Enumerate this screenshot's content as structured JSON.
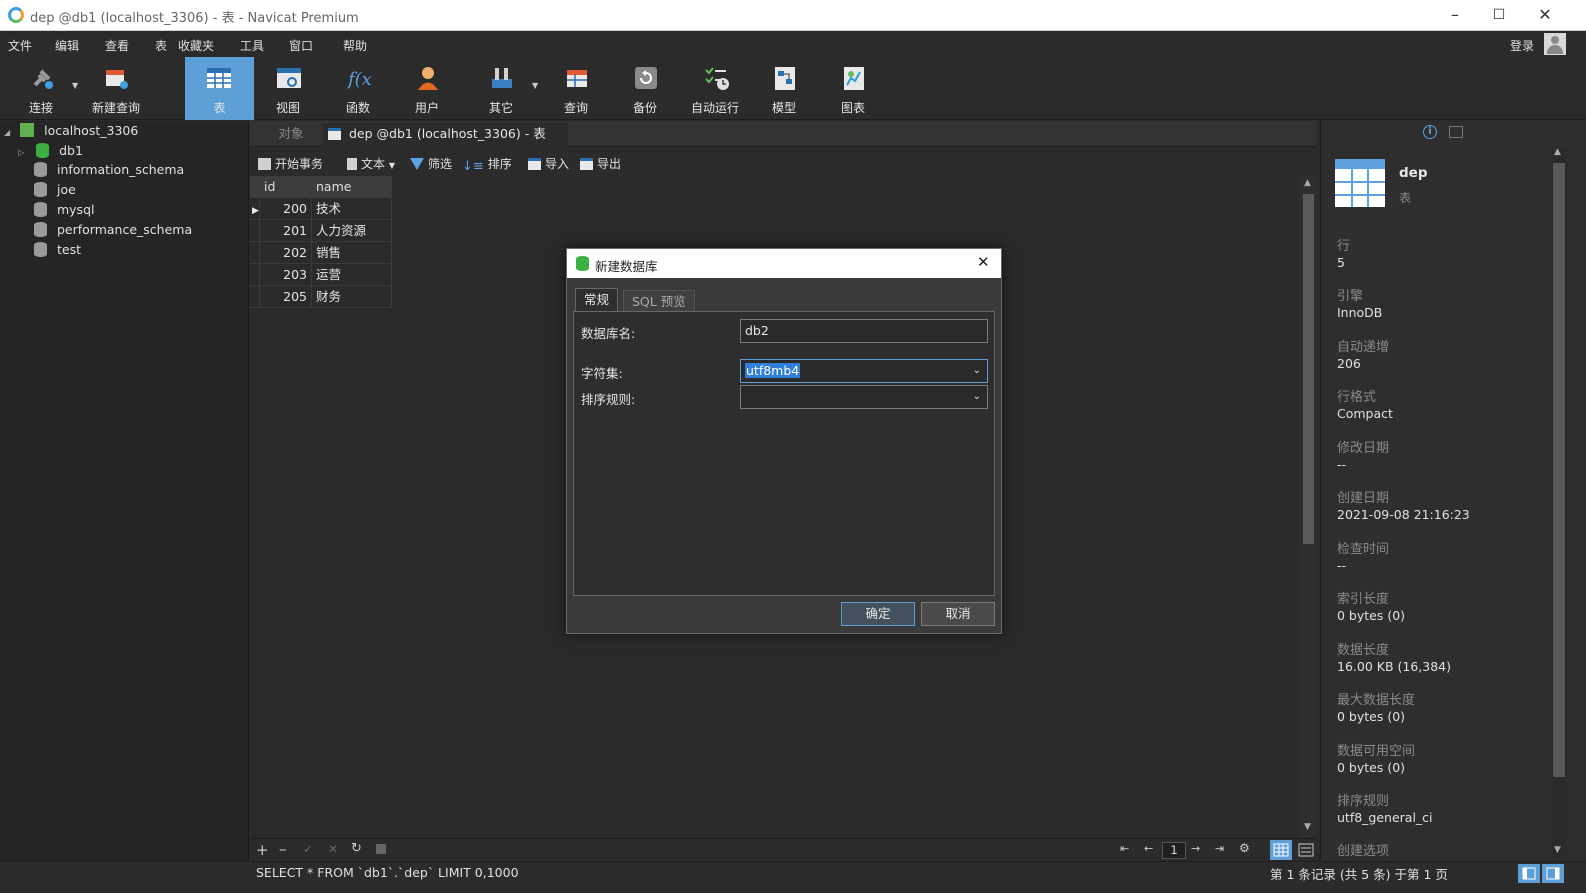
{
  "window": {
    "title": "dep @db1 (localhost_3306) - 表 - Navicat Premium"
  },
  "menu": [
    "文件",
    "编辑",
    "查看",
    "表",
    "收藏夹",
    "工具",
    "窗口",
    "帮助"
  ],
  "login_label": "登录",
  "toolbar": {
    "items": [
      {
        "label": "连接",
        "icon": "plug-icon"
      },
      {
        "label": "新建查询",
        "icon": "new-query-icon"
      },
      {
        "label": "表",
        "icon": "table-icon",
        "active": true
      },
      {
        "label": "视图",
        "icon": "view-icon"
      },
      {
        "label": "函数",
        "icon": "function-icon"
      },
      {
        "label": "用户",
        "icon": "user-icon"
      },
      {
        "label": "其它",
        "icon": "tools-icon"
      },
      {
        "label": "查询",
        "icon": "query-icon"
      },
      {
        "label": "备份",
        "icon": "backup-icon"
      },
      {
        "label": "自动运行",
        "icon": "schedule-icon"
      },
      {
        "label": "模型",
        "icon": "model-icon"
      },
      {
        "label": "图表",
        "icon": "chart-icon"
      }
    ]
  },
  "tree": {
    "connection": "localhost_3306",
    "databases": [
      "db1",
      "information_schema",
      "joe",
      "mysql",
      "performance_schema",
      "test"
    ]
  },
  "tabs": {
    "objects": "对象",
    "active": "dep @db1 (localhost_3306) - 表"
  },
  "table_toolbar": {
    "begin_transaction": "开始事务",
    "text": "文本",
    "filter": "筛选",
    "sort": "排序",
    "import": "导入",
    "export": "导出"
  },
  "grid": {
    "columns": [
      "id",
      "name"
    ],
    "rows": [
      [
        "200",
        "技术"
      ],
      [
        "201",
        "人力资源"
      ],
      [
        "202",
        "销售"
      ],
      [
        "203",
        "运营"
      ],
      [
        "205",
        "财务"
      ]
    ]
  },
  "nav": {
    "page": "1"
  },
  "status": {
    "sql": "SELECT * FROM `db1`.`dep` LIMIT 0,1000",
    "records": "第 1 条记录 (共 5 条) 于第 1 页"
  },
  "info": {
    "name": "dep",
    "type": "表",
    "fields": [
      {
        "label": "行",
        "value": "5"
      },
      {
        "label": "引擎",
        "value": "InnoDB"
      },
      {
        "label": "自动递增",
        "value": "206"
      },
      {
        "label": "行格式",
        "value": "Compact"
      },
      {
        "label": "修改日期",
        "value": "--"
      },
      {
        "label": "创建日期",
        "value": "2021-09-08 21:16:23"
      },
      {
        "label": "检查时间",
        "value": "--"
      },
      {
        "label": "索引长度",
        "value": "0 bytes (0)"
      },
      {
        "label": "数据长度",
        "value": "16.00 KB (16,384)"
      },
      {
        "label": "最大数据长度",
        "value": "0 bytes (0)"
      },
      {
        "label": "数据可用空间",
        "value": "0 bytes (0)"
      },
      {
        "label": "排序规则",
        "value": "utf8_general_ci"
      },
      {
        "label": "创建选项",
        "value": ""
      }
    ]
  },
  "dialog": {
    "title": "新建数据库",
    "tab_general": "常规",
    "tab_sql": "SQL 预览",
    "db_name_label": "数据库名:",
    "db_name_value": "db2",
    "charset_label": "字符集:",
    "charset_value": "utf8mb4",
    "collation_label": "排序规则:",
    "collation_value": "",
    "ok": "确定",
    "cancel": "取消"
  },
  "colors": {
    "accent": "#5f9fd8",
    "db_green": "#3cb043",
    "background": "#2b2b2b"
  }
}
